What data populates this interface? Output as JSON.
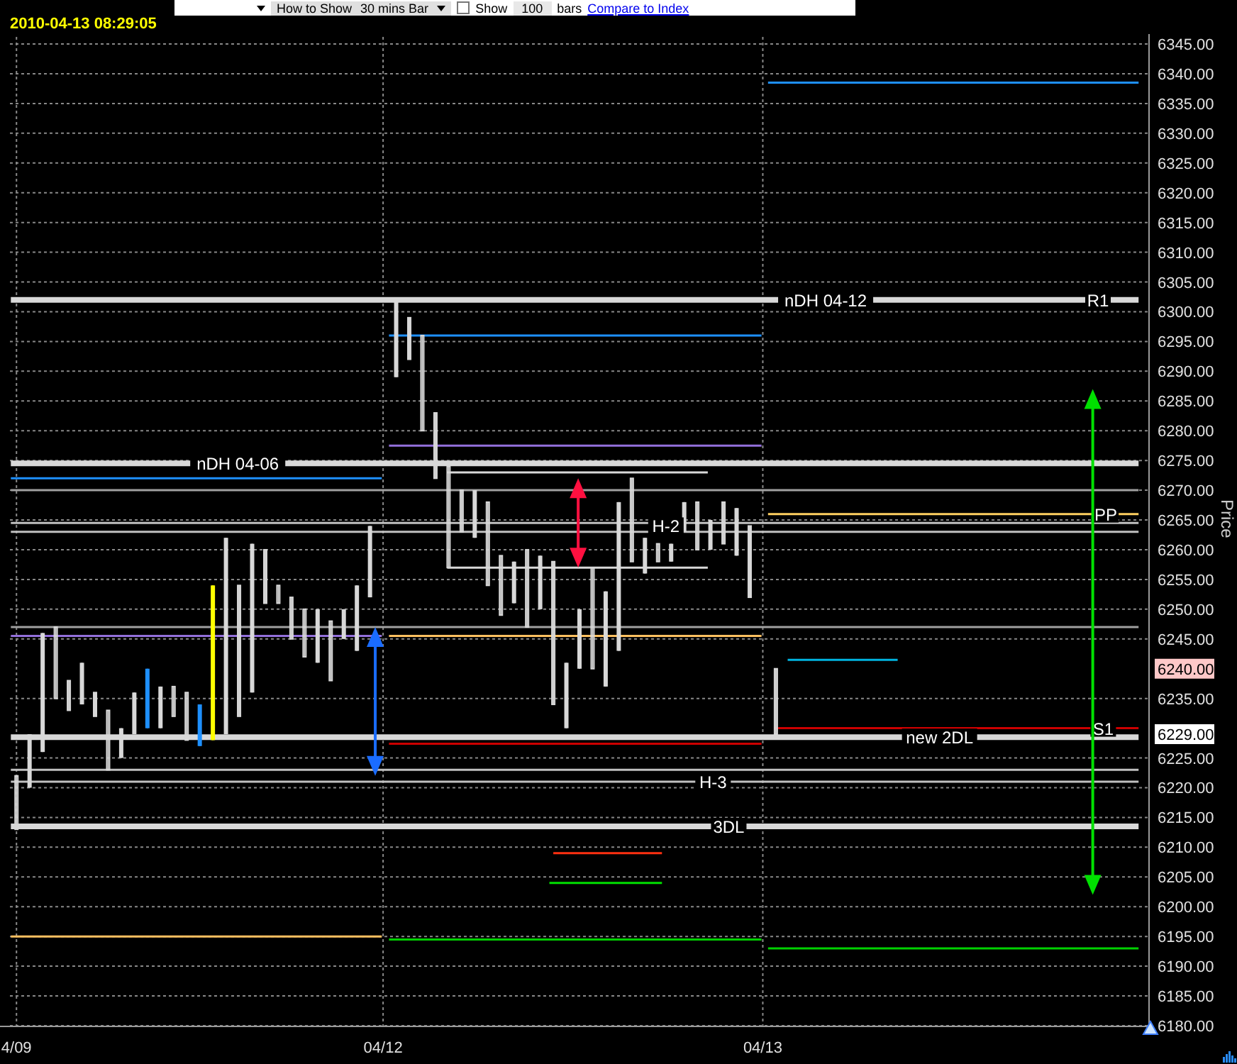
{
  "toolbar": {
    "show_label": "How to Show",
    "interval": "30 mins Bar",
    "show_checked": false,
    "show_text": "Show",
    "bar_count": "100",
    "bars_text": "bars",
    "compare_link": "Compare to Index"
  },
  "timestamp": "2010-04-13 08:29:05",
  "chart_data": {
    "type": "candlestick",
    "ylabel": "Price",
    "grid": true,
    "ylim": [
      6180,
      6345
    ],
    "categories": [
      "4/09",
      null,
      null,
      null,
      null,
      null,
      null,
      null,
      null,
      null,
      null,
      null,
      null,
      null,
      null,
      null,
      null,
      null,
      null,
      null,
      null,
      null,
      null,
      null,
      null,
      null,
      null,
      null,
      "04/12",
      null,
      null,
      null,
      null,
      null,
      null,
      null,
      null,
      null,
      null,
      null,
      null,
      null,
      null,
      null,
      null,
      null,
      null,
      null,
      null,
      null,
      null,
      null,
      null,
      null,
      null,
      null,
      null,
      "04/13",
      null,
      null,
      null,
      null,
      null,
      null,
      null,
      null,
      null,
      null,
      null,
      null,
      null,
      null,
      null,
      null,
      null,
      null,
      null,
      null,
      null,
      null,
      null,
      null,
      null,
      null,
      null,
      null,
      null
    ],
    "yticks": [
      {
        "value": 6180,
        "label": "6180.00"
      },
      {
        "value": 6185,
        "label": "6185.00"
      },
      {
        "value": 6190,
        "label": "6190.00"
      },
      {
        "value": 6195,
        "label": "6195.00"
      },
      {
        "value": 6200,
        "label": "6200.00"
      },
      {
        "value": 6205,
        "label": "6205.00"
      },
      {
        "value": 6210,
        "label": "6210.00"
      },
      {
        "value": 6215,
        "label": "6215.00"
      },
      {
        "value": 6220,
        "label": "6220.00"
      },
      {
        "value": 6225,
        "label": "6225.00"
      },
      {
        "value": 6235,
        "label": "6235.00"
      },
      {
        "value": 6245,
        "label": "6245.00"
      },
      {
        "value": 6250,
        "label": "6250.00"
      },
      {
        "value": 6255,
        "label": "6255.00"
      },
      {
        "value": 6260,
        "label": "6260.00"
      },
      {
        "value": 6265,
        "label": "6265.00"
      },
      {
        "value": 6270,
        "label": "6270.00"
      },
      {
        "value": 6275,
        "label": "6275.00"
      },
      {
        "value": 6280,
        "label": "6280.00"
      },
      {
        "value": 6285,
        "label": "6285.00"
      },
      {
        "value": 6290,
        "label": "6290.00"
      },
      {
        "value": 6295,
        "label": "6295.00"
      },
      {
        "value": 6300,
        "label": "6300.00"
      },
      {
        "value": 6305,
        "label": "6305.00"
      },
      {
        "value": 6310,
        "label": "6310.00"
      },
      {
        "value": 6315,
        "label": "6315.00"
      },
      {
        "value": 6320,
        "label": "6320.00"
      },
      {
        "value": 6325,
        "label": "6325.00"
      },
      {
        "value": 6330,
        "label": "6330.00"
      },
      {
        "value": 6335,
        "label": "6335.00"
      },
      {
        "value": 6340,
        "label": "6340.00"
      },
      {
        "value": 6345,
        "label": "6345.00"
      }
    ],
    "series": [
      {
        "color": "#d8d8d8",
        "ohlc": [
          [
            6222,
            6222,
            6213,
            6213
          ],
          [
            6220,
            6229,
            6220,
            6229
          ],
          [
            6226,
            6246,
            6226,
            6246
          ],
          [
            6247,
            6247,
            6235,
            6235
          ],
          [
            6238,
            6238,
            6233,
            6233
          ],
          [
            6234,
            6241,
            6234,
            6241
          ],
          [
            6236,
            6236,
            6232,
            6232
          ],
          [
            6233,
            6233,
            6223,
            6223
          ],
          [
            6225,
            6230,
            6225,
            6230
          ],
          [
            6229,
            6236,
            6229,
            6236
          ],
          null,
          [
            6230,
            6237,
            6230,
            6237
          ],
          [
            6237,
            6237,
            6232,
            6232
          ],
          [
            6236,
            6236,
            6228,
            6228
          ],
          null,
          null,
          [
            6229,
            6262,
            6229,
            6262
          ],
          [
            6254,
            6254,
            6232,
            6232
          ],
          [
            6236,
            6261,
            6236,
            6261
          ],
          [
            6260,
            6260,
            6251,
            6251
          ],
          [
            6254,
            6254,
            6251,
            6251
          ],
          [
            6252,
            6252,
            6245,
            6245
          ],
          [
            6250,
            6250,
            6242,
            6242
          ],
          [
            6241,
            6250,
            6241,
            6250
          ],
          [
            6248,
            6248,
            6238,
            6238
          ],
          [
            6245,
            6250,
            6245,
            6250
          ],
          [
            6243,
            6254,
            6243,
            6254
          ],
          [
            6252,
            6264,
            6252,
            6264
          ],
          null,
          [
            6289,
            6302,
            6289,
            6302
          ],
          [
            6299,
            6299,
            6292,
            6292
          ],
          [
            6296,
            6296,
            6280,
            6280
          ],
          [
            6283,
            6283,
            6272,
            6272
          ],
          [
            6274,
            6274,
            6257,
            6257
          ],
          [
            6270,
            6270,
            6263,
            6263
          ],
          [
            6262,
            6270,
            6262,
            6270
          ],
          [
            6268,
            6268,
            6254,
            6254
          ],
          [
            6259,
            6259,
            6249,
            6249
          ],
          [
            6251,
            6258,
            6251,
            6258
          ],
          [
            6260,
            6260,
            6247,
            6247
          ],
          [
            6250,
            6259,
            6250,
            6259
          ],
          [
            6258,
            6258,
            6234,
            6234
          ],
          [
            6230,
            6241,
            6230,
            6241
          ],
          [
            6240,
            6250,
            6240,
            6250
          ],
          [
            6257,
            6257,
            6240,
            6240
          ],
          [
            6237,
            6253,
            6237,
            6253
          ],
          [
            6243,
            6268,
            6243,
            6268
          ],
          [
            6272,
            6272,
            6258,
            6258
          ],
          [
            6256,
            6262,
            6256,
            6262
          ],
          [
            6261,
            6261,
            6258,
            6258
          ],
          [
            6258,
            6261,
            6258,
            6261
          ],
          [
            6263,
            6268,
            6263,
            6268
          ],
          [
            6268,
            6268,
            6260,
            6260
          ],
          [
            6260,
            6265,
            6260,
            6265
          ],
          [
            6268,
            6268,
            6261,
            6261
          ],
          [
            6259,
            6267,
            6259,
            6267
          ],
          [
            6264,
            6264,
            6252,
            6252
          ],
          null,
          [
            6240,
            6240,
            6229,
            6229
          ],
          null,
          null,
          null,
          null,
          null,
          null,
          null,
          null,
          null,
          null,
          null,
          null,
          null,
          null,
          null,
          null,
          null,
          null,
          null,
          null,
          null,
          null,
          null,
          null,
          null,
          null,
          null,
          null
        ]
      },
      {
        "color": "#1e90ff",
        "ohlc": [
          null,
          null,
          null,
          null,
          null,
          null,
          null,
          null,
          null,
          null,
          [
            6230,
            6240,
            6230,
            6240
          ],
          null,
          null,
          null,
          [
            6227,
            6234,
            6227,
            6234
          ],
          null,
          null,
          null,
          null,
          null,
          null,
          null,
          null,
          null,
          null,
          null,
          null,
          null,
          null,
          null,
          null,
          null,
          null,
          null,
          null,
          null,
          null,
          null,
          null,
          null,
          null,
          null,
          null,
          null,
          null,
          null,
          null,
          null,
          null,
          null,
          null,
          null,
          null,
          null,
          null,
          null,
          null,
          null,
          null,
          null,
          null,
          null,
          null,
          null,
          null,
          null,
          null,
          null,
          null,
          null,
          null,
          null,
          null,
          null,
          null,
          null,
          null,
          null,
          null,
          null,
          null,
          null,
          null,
          null,
          null,
          null,
          null
        ]
      },
      {
        "color": "#ffff00",
        "ohlc": [
          null,
          null,
          null,
          null,
          null,
          null,
          null,
          null,
          null,
          null,
          null,
          null,
          null,
          null,
          null,
          [
            6228,
            6254,
            6228,
            6254
          ],
          null,
          null,
          null,
          null,
          null,
          null,
          null,
          null,
          null,
          null,
          null,
          null,
          null,
          null,
          null,
          null,
          null,
          null,
          null,
          null,
          null,
          null,
          null,
          null,
          null,
          null,
          null,
          null,
          null,
          null,
          null,
          null,
          null,
          null,
          null,
          null,
          null,
          null,
          null,
          null,
          null,
          null,
          null,
          null,
          null,
          null,
          null,
          null,
          null,
          null,
          null,
          null,
          null,
          null,
          null,
          null,
          null,
          null,
          null,
          null,
          null,
          null,
          null,
          null,
          null,
          null,
          null,
          null,
          null,
          null,
          null
        ]
      }
    ],
    "ref_lines": [
      {
        "axis": "y",
        "value": 6338.5,
        "color": "#1e90ff"
      },
      {
        "axis": "y",
        "value": 6302,
        "color": "#d8d8d8"
      },
      {
        "axis": "y",
        "value": 6296,
        "color": "#1e90ff"
      },
      {
        "axis": "y",
        "value": 6277.5,
        "color": "#9370db"
      },
      {
        "axis": "y",
        "value": 6274.5,
        "color": "#d8d8d8"
      },
      {
        "axis": "y",
        "value": 6273,
        "color": "#d8d8d8"
      },
      {
        "axis": "y",
        "value": 6272,
        "color": "#1e90ff"
      },
      {
        "axis": "y",
        "value": 6270,
        "color": "#a0a0a0"
      },
      {
        "axis": "y",
        "value": 6266,
        "color": "#ffd060"
      },
      {
        "axis": "y",
        "value": 6264.5,
        "color": "#c0c0c0"
      },
      {
        "axis": "y",
        "value": 6263,
        "color": "#c0c0c0"
      },
      {
        "axis": "y",
        "value": 6257,
        "color": "#d8d8d8"
      },
      {
        "axis": "y",
        "value": 6247,
        "color": "#a0a0a0"
      },
      {
        "axis": "y",
        "value": 6245.5,
        "color": "#9370db"
      },
      {
        "axis": "y",
        "value": 6245.5,
        "color": "#ffc060"
      },
      {
        "axis": "y",
        "value": 6241.5,
        "color": "#00b4e0"
      },
      {
        "axis": "y",
        "value": 6230,
        "color": "#cc0000"
      },
      {
        "axis": "y",
        "value": 6228.5,
        "color": "#d8d8d8"
      },
      {
        "axis": "y",
        "value": 6227.4,
        "color": "#cc0000"
      },
      {
        "axis": "y",
        "value": 6223,
        "color": "#c0c0c0"
      },
      {
        "axis": "y",
        "value": 6221,
        "color": "#c0c0c0"
      },
      {
        "axis": "y",
        "value": 6213.5,
        "color": "#d8d8d8"
      },
      {
        "axis": "y",
        "value": 6209,
        "color": "#ff3010"
      },
      {
        "axis": "y",
        "value": 6204,
        "color": "#00e000"
      },
      {
        "axis": "y",
        "value": 6195,
        "color": "#ffc060"
      },
      {
        "axis": "y",
        "value": 6194.5,
        "color": "#00d000"
      },
      {
        "axis": "y",
        "value": 6193,
        "color": "#00d000"
      }
    ],
    "annotations": [
      "nDH 04-12",
      "R1",
      "nDH 04-06",
      "H-2",
      "PP",
      "S1",
      "new 2DL",
      "H-3",
      "3DL"
    ]
  },
  "price_markers": [
    {
      "text": "6240.00",
      "color": "#ffc8c8"
    },
    {
      "text": "6229.00",
      "color": "#ffffff"
    }
  ]
}
